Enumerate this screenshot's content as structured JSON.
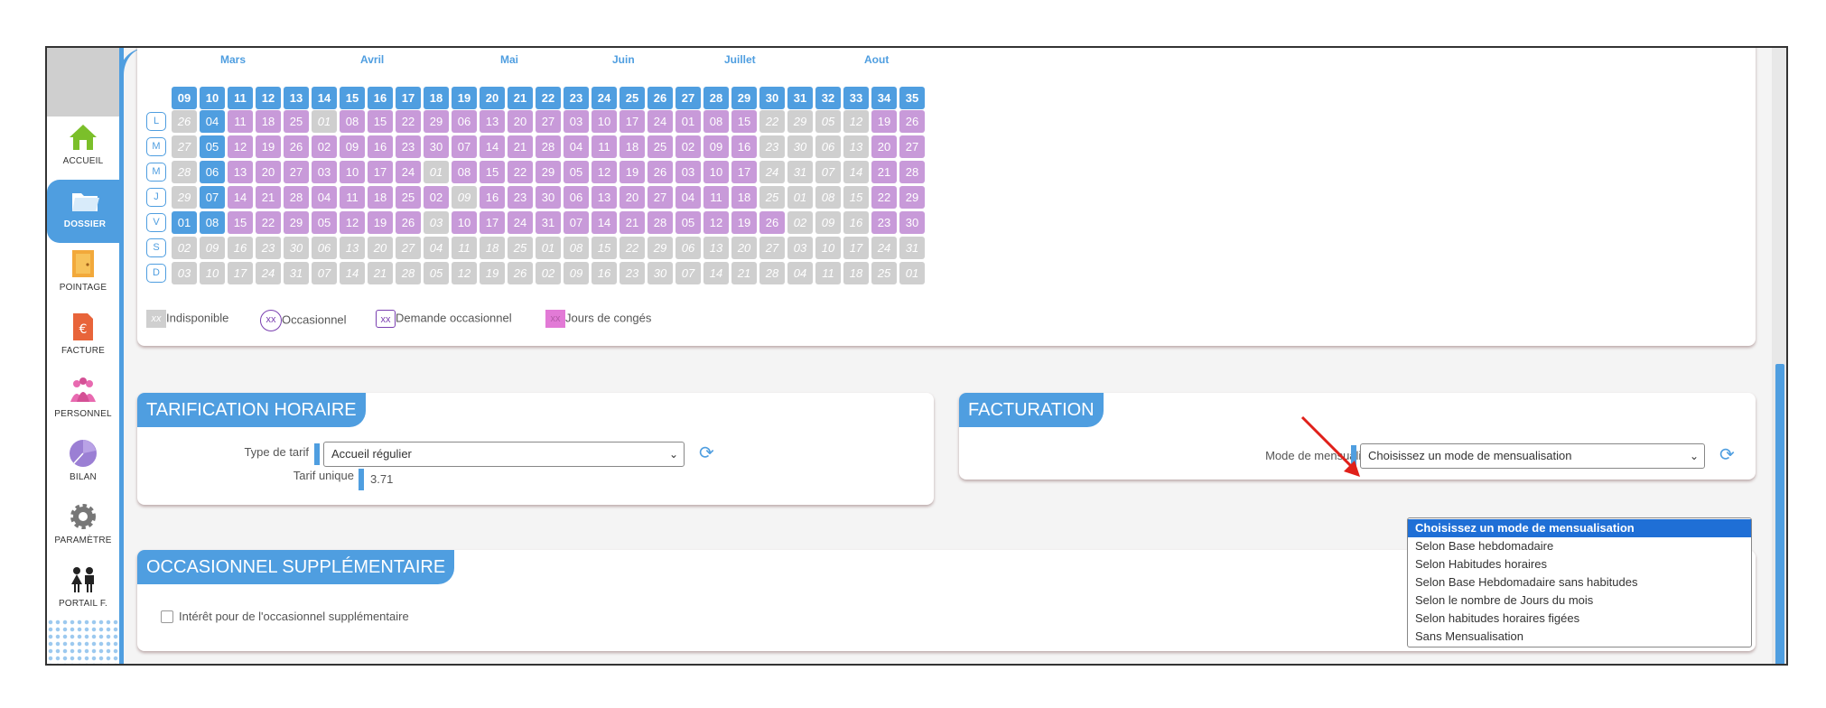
{
  "sidebar": {
    "items": [
      {
        "label": "ACCUEIL",
        "icon": "home-icon"
      },
      {
        "label": "DOSSIER",
        "icon": "folder-icon"
      },
      {
        "label": "POINTAGE",
        "icon": "door-icon"
      },
      {
        "label": "FACTURE",
        "icon": "invoice-icon"
      },
      {
        "label": "PERSONNEL",
        "icon": "people-icon"
      },
      {
        "label": "BILAN",
        "icon": "pie-chart-icon"
      },
      {
        "label": "PARAMÈTRE",
        "icon": "gear-icon"
      },
      {
        "label": "PORTAIL F.",
        "icon": "family-icon"
      }
    ]
  },
  "calendar": {
    "months": [
      "Mars",
      "Avril",
      "Mai",
      "Juin",
      "Juillet",
      "Aout"
    ],
    "weeks": [
      "09",
      "10",
      "11",
      "12",
      "13",
      "14",
      "15",
      "16",
      "17",
      "18",
      "19",
      "20",
      "21",
      "22",
      "23",
      "24",
      "25",
      "26",
      "27",
      "28",
      "29",
      "30",
      "31",
      "32",
      "33",
      "34",
      "35"
    ],
    "day_labels": [
      "L",
      "M",
      "M",
      "J",
      "V",
      "S",
      "D"
    ],
    "rows": [
      [
        "26",
        "04",
        "11",
        "18",
        "25",
        "01",
        "08",
        "15",
        "22",
        "29",
        "06",
        "13",
        "20",
        "27",
        "03",
        "10",
        "17",
        "24",
        "01",
        "08",
        "15",
        "22",
        "29",
        "05",
        "12",
        "19",
        "26"
      ],
      [
        "27",
        "05",
        "12",
        "19",
        "26",
        "02",
        "09",
        "16",
        "23",
        "30",
        "07",
        "14",
        "21",
        "28",
        "04",
        "11",
        "18",
        "25",
        "02",
        "09",
        "16",
        "23",
        "30",
        "06",
        "13",
        "20",
        "27"
      ],
      [
        "28",
        "06",
        "13",
        "20",
        "27",
        "03",
        "10",
        "17",
        "24",
        "01",
        "08",
        "15",
        "22",
        "29",
        "05",
        "12",
        "19",
        "26",
        "03",
        "10",
        "17",
        "24",
        "31",
        "07",
        "14",
        "21",
        "28"
      ],
      [
        "29",
        "07",
        "14",
        "21",
        "28",
        "04",
        "11",
        "18",
        "25",
        "02",
        "09",
        "16",
        "23",
        "30",
        "06",
        "13",
        "20",
        "27",
        "04",
        "11",
        "18",
        "25",
        "01",
        "08",
        "15",
        "22",
        "29"
      ],
      [
        "01",
        "08",
        "15",
        "22",
        "29",
        "05",
        "12",
        "19",
        "26",
        "03",
        "10",
        "17",
        "24",
        "31",
        "07",
        "14",
        "21",
        "28",
        "05",
        "12",
        "19",
        "26",
        "02",
        "09",
        "16",
        "23",
        "30"
      ],
      [
        "02",
        "09",
        "16",
        "23",
        "30",
        "06",
        "13",
        "20",
        "27",
        "04",
        "11",
        "18",
        "25",
        "01",
        "08",
        "15",
        "22",
        "29",
        "06",
        "13",
        "20",
        "27",
        "03",
        "10",
        "17",
        "24",
        "31"
      ],
      [
        "03",
        "10",
        "17",
        "24",
        "31",
        "07",
        "14",
        "21",
        "28",
        "05",
        "12",
        "19",
        "26",
        "02",
        "09",
        "16",
        "23",
        "30",
        "07",
        "14",
        "21",
        "28",
        "04",
        "11",
        "18",
        "25",
        "01"
      ]
    ],
    "legend": [
      {
        "swatch": "xx",
        "label": "Indisponible"
      },
      {
        "swatch": "xx",
        "label": "Occasionnel"
      },
      {
        "swatch": "xx",
        "label": "Demande occasionnel"
      },
      {
        "swatch": "xx",
        "label": "Jours de congés"
      }
    ]
  },
  "tarification": {
    "title": "TARIFICATION HORAIRE",
    "type_label": "Type de tarif",
    "type_value": "Accueil régulier",
    "unique_label": "Tarif unique",
    "unique_value": "3.71"
  },
  "facturation": {
    "title": "FACTURATION",
    "mode_label": "Mode de mensualisation",
    "mode_value": "Choisissez un mode de mensualisation",
    "options": [
      "Choisissez un mode de mensualisation",
      "Selon Base hebdomadaire",
      "Selon Habitudes horaires",
      "Selon Base Hebdomadaire sans habitudes",
      "Selon le nombre de Jours du mois",
      "Selon habitudes horaires figées",
      "Sans Mensualisation"
    ]
  },
  "occasionnel": {
    "title": "OCCASIONNEL SUPPLÉMENTAIRE",
    "checkbox_label": "Intérêt pour de l'occasionnel supplémentaire"
  },
  "colors": {
    "accent": "#4f9ee0",
    "holiday": "#c89ad9",
    "unavailable": "#cfcfcf",
    "selected": "#1f6fd6"
  }
}
